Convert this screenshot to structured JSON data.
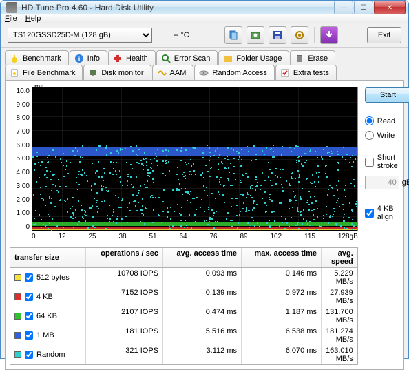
{
  "window": {
    "title": "HD Tune Pro 4.60 - Hard Disk Utility"
  },
  "menubar": {
    "file": "File",
    "help": "Help"
  },
  "toolbar": {
    "device": "TS120GSSD25D-M (128 gB)",
    "temp": "-- °C",
    "exit": "Exit"
  },
  "tabs": {
    "row1": [
      {
        "id": "benchmark",
        "label": "Benchmark"
      },
      {
        "id": "info",
        "label": "Info"
      },
      {
        "id": "health",
        "label": "Health"
      },
      {
        "id": "error-scan",
        "label": "Error Scan"
      },
      {
        "id": "folder-usage",
        "label": "Folder Usage"
      },
      {
        "id": "erase",
        "label": "Erase"
      }
    ],
    "row2": [
      {
        "id": "file-benchmark",
        "label": "File Benchmark"
      },
      {
        "id": "disk-monitor",
        "label": "Disk monitor"
      },
      {
        "id": "aam",
        "label": "AAM"
      },
      {
        "id": "random-access",
        "label": "Random Access",
        "active": true
      },
      {
        "id": "extra-tests",
        "label": "Extra tests"
      }
    ]
  },
  "controls": {
    "start": "Start",
    "read": "Read",
    "write": "Write",
    "short_stroke": "Short stroke",
    "stroke_value": "40",
    "stroke_unit": "gB",
    "align_4kb": "4 KB align"
  },
  "graph": {
    "y_unit": "ms",
    "y_ticks": [
      "10.0",
      "9.00",
      "8.00",
      "7.00",
      "6.00",
      "5.00",
      "4.00",
      "3.00",
      "2.00",
      "1.00",
      "0"
    ],
    "x_ticks": [
      "0",
      "12",
      "25",
      "38",
      "51",
      "64",
      "76",
      "89",
      "102",
      "115",
      "128gB"
    ]
  },
  "results": {
    "headers": [
      "transfer size",
      "operations / sec",
      "avg. access time",
      "max. access time",
      "avg. speed"
    ],
    "rows": [
      {
        "color": "#f4e242",
        "size": "512 bytes",
        "ops": "10708 IOPS",
        "avg": "0.093 ms",
        "max": "0.146 ms",
        "speed": "5.229 MB/s"
      },
      {
        "color": "#d83030",
        "size": "4 KB",
        "ops": "7152 IOPS",
        "avg": "0.139 ms",
        "max": "0.972 ms",
        "speed": "27.939 MB/s"
      },
      {
        "color": "#30c030",
        "size": "64 KB",
        "ops": "2107 IOPS",
        "avg": "0.474 ms",
        "max": "1.187 ms",
        "speed": "131.700 MB/s"
      },
      {
        "color": "#3060e0",
        "size": "1 MB",
        "ops": "181 IOPS",
        "avg": "5.516 ms",
        "max": "6.538 ms",
        "speed": "181.274 MB/s"
      },
      {
        "color": "#30d0d0",
        "size": "Random",
        "ops": "321 IOPS",
        "avg": "3.112 ms",
        "max": "6.070 ms",
        "speed": "163.010 MB/s"
      }
    ]
  },
  "chart_data": {
    "type": "scatter",
    "title": "Random Access",
    "xlabel": "gB",
    "ylabel": "ms",
    "xlim": [
      0,
      128
    ],
    "ylim": [
      0,
      10
    ],
    "series": [
      {
        "name": "512 bytes",
        "color": "#f4e242",
        "approx_band_ms": [
          0.05,
          0.15
        ]
      },
      {
        "name": "4 KB",
        "color": "#d83030",
        "approx_band_ms": [
          0.1,
          0.25
        ]
      },
      {
        "name": "64 KB",
        "color": "#30c030",
        "approx_band_ms": [
          0.35,
          0.6
        ]
      },
      {
        "name": "1 MB",
        "color": "#3060e0",
        "approx_band_ms": [
          5.2,
          5.8
        ]
      },
      {
        "name": "Random",
        "color": "#30d0d0",
        "approx_band_ms": [
          0.1,
          6.0
        ],
        "scatter": true
      }
    ],
    "note": "Scatter points are dense and uniformly distributed across x; values estimated from bands."
  }
}
